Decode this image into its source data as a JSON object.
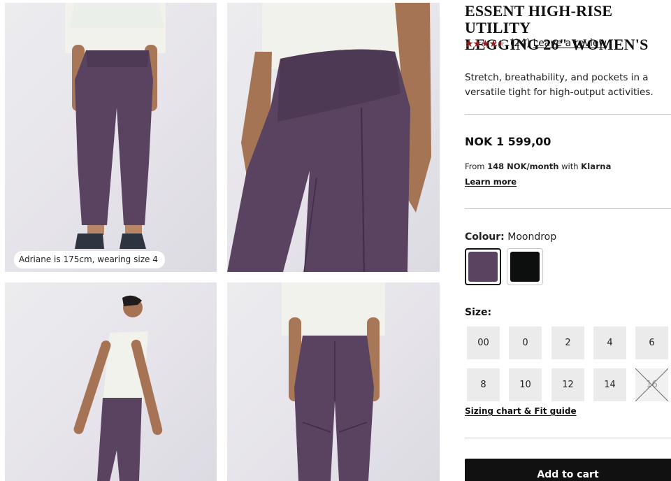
{
  "gallery": {
    "caption": "Adriane is 175cm, wearing size 4"
  },
  "product": {
    "title_line1": "ESSENT HIGH-RISE UTILITY",
    "title_line2": "LEGGING 26\" WOMEN'S",
    "rating": {
      "value": 4.5,
      "max": 5,
      "count": "(24)",
      "review_link": "Leave a review",
      "star_color": "#9b1b1b"
    },
    "description": "Stretch, breathability, and pockets in a versatile tight for high-output activities.",
    "price": "NOK 1 599,00",
    "klarna": {
      "from": "From",
      "amount": "148 NOK/month",
      "with": "with",
      "brand": "Klarna",
      "learn_more": "Learn more"
    },
    "colour": {
      "label": "Colour:",
      "selected": "Moondrop",
      "swatches": [
        {
          "name": "Moondrop",
          "hex": "#5a4360",
          "selected": true
        },
        {
          "name": "Black",
          "hex": "#0d0f0e",
          "selected": false
        }
      ]
    },
    "size": {
      "label": "Size:",
      "options": [
        {
          "label": "00",
          "available": true
        },
        {
          "label": "0",
          "available": true
        },
        {
          "label": "2",
          "available": true
        },
        {
          "label": "4",
          "available": true
        },
        {
          "label": "6",
          "available": true
        },
        {
          "label": "8",
          "available": true
        },
        {
          "label": "10",
          "available": true
        },
        {
          "label": "12",
          "available": true
        },
        {
          "label": "14",
          "available": true
        },
        {
          "label": "16",
          "available": false
        }
      ],
      "sizing_link": "Sizing chart & Fit guide"
    },
    "add_to_cart": "Add to cart"
  },
  "colors": {
    "legging": "#5a4360",
    "cart_bg": "#111111"
  }
}
